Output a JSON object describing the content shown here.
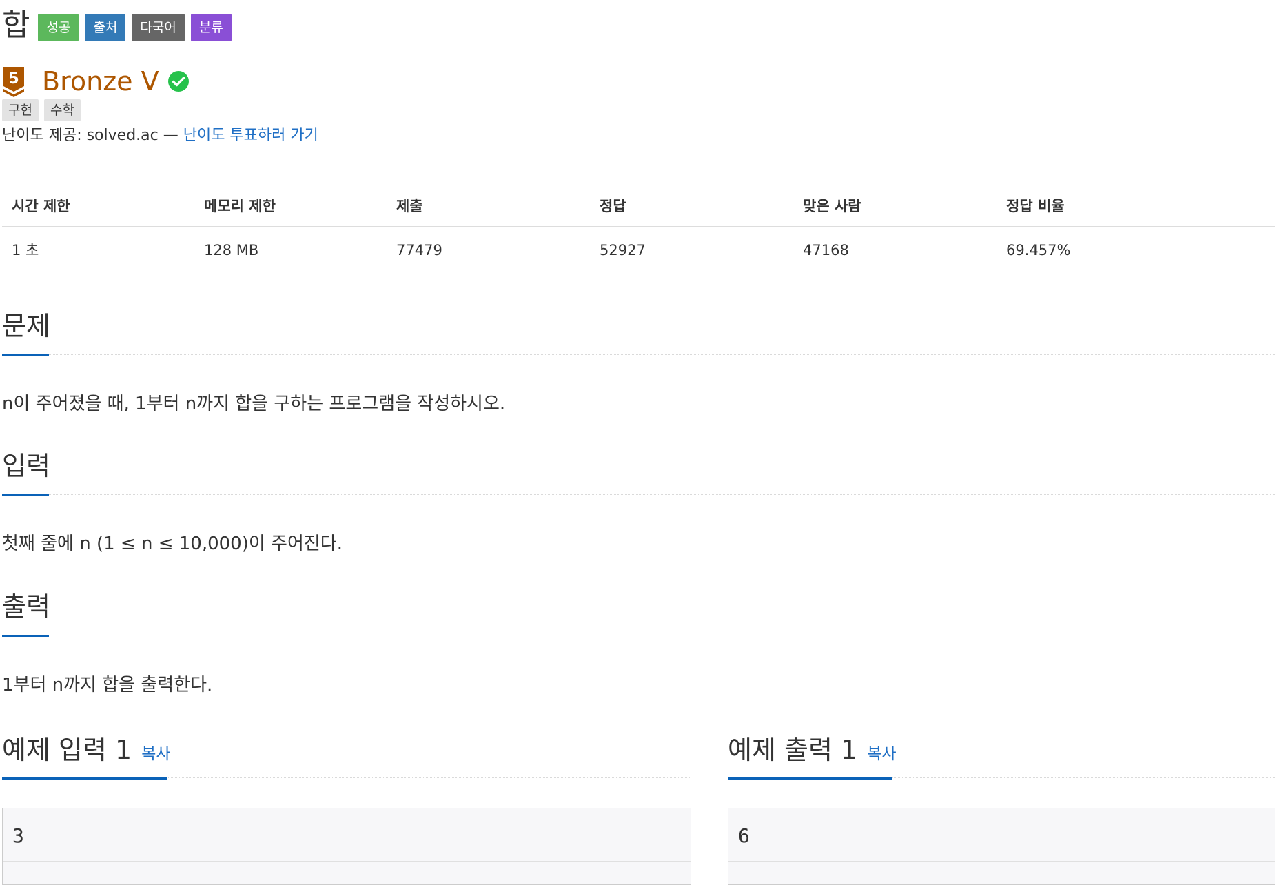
{
  "problem": {
    "title": "합",
    "badges": [
      {
        "label": "성공",
        "color": "#5cb85c"
      },
      {
        "label": "출처",
        "color": "#337ab7"
      },
      {
        "label": "다국어",
        "color": "#666666"
      },
      {
        "label": "분류",
        "color": "#8a4fd6"
      }
    ]
  },
  "tier": {
    "level": "5",
    "name": "Bronze V",
    "color": "#ad5600",
    "check_icon": "check-circle-icon",
    "check_color": "#27c24c"
  },
  "tags": [
    "구현",
    "수학"
  ],
  "difficulty_provider": {
    "text": "난이도 제공: solved.ac —",
    "link": "난이도 투표하러 가기"
  },
  "stats": {
    "headers": [
      "시간 제한",
      "메모리 제한",
      "제출",
      "정답",
      "맞은 사람",
      "정답 비율"
    ],
    "values": [
      "1 초",
      "128 MB",
      "77479",
      "52927",
      "47168",
      "69.457%"
    ]
  },
  "sections": {
    "problem": {
      "heading": "문제",
      "text": "n이 주어졌을 때, 1부터 n까지 합을 구하는 프로그램을 작성하시오."
    },
    "input": {
      "heading": "입력",
      "text": "첫째 줄에 n (1 ≤ n ≤ 10,000)이 주어진다."
    },
    "output": {
      "heading": "출력",
      "text": "1부터 n까지 합을 출력한다."
    }
  },
  "samples": {
    "input": {
      "heading": "예제 입력 1",
      "copy": "복사",
      "value": "3"
    },
    "output": {
      "heading": "예제 출력 1",
      "copy": "복사",
      "value": "6"
    }
  }
}
